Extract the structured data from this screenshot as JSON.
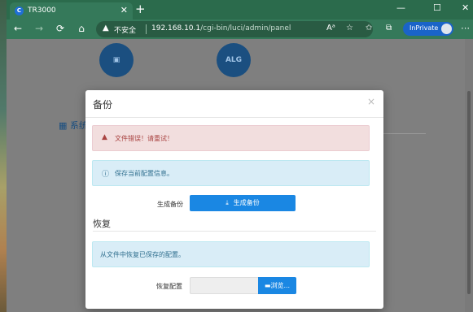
{
  "browser": {
    "tab_title": "TR3000",
    "favicon_letter": "C",
    "insecure_label": "不安全",
    "url_host": "192.168.10.1",
    "url_path": "/cgi-bin/luci/admin/panel",
    "inprivate_label": "InPrivate",
    "window_controls": {
      "minimize": "—",
      "maximize": "☐",
      "close": "✕"
    },
    "new_tab": "+",
    "tab_close": "✕",
    "nav": {
      "back": "←",
      "forward": "→",
      "reload": "⟳",
      "home": "⌂",
      "menu": "⋯"
    }
  },
  "background_page": {
    "icon_alg": "ALG",
    "section_title": "系统"
  },
  "modal": {
    "title": "备份",
    "close": "×",
    "error_alert": "文件错误！请重试！",
    "save_info": "保存当前配置信息。",
    "backup_label": "生成备份",
    "backup_button": "生成备份",
    "restore_title": "恢复",
    "restore_info": "从文件中恢复已保存的配置。",
    "restore_label": "恢复配置",
    "browse_button": "浏览..."
  },
  "colors": {
    "browser_frame": "#35795a",
    "primary_button": "#1a87e3",
    "danger_bg": "#f2dede",
    "info_bg": "#d9edf7"
  }
}
